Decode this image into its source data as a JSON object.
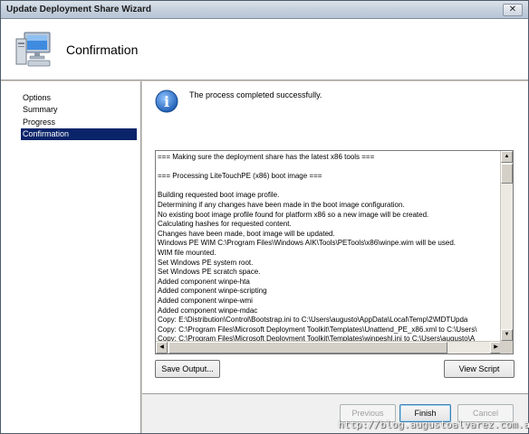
{
  "window": {
    "title": "Update Deployment Share Wizard",
    "close_glyph": "✕"
  },
  "header": {
    "heading": "Confirmation",
    "icon": "computer-monitor-icon"
  },
  "sidebar": {
    "items": [
      {
        "label": "Options",
        "active": false
      },
      {
        "label": "Summary",
        "active": false
      },
      {
        "label": "Progress",
        "active": false
      },
      {
        "label": "Confirmation",
        "active": true
      }
    ]
  },
  "main": {
    "status_icon": "info-icon",
    "status_icon_glyph": "i",
    "status_text": "The process completed successfully.",
    "log_lines": [
      "=== Making sure the deployment share has the latest x86 tools ===",
      "",
      "=== Processing LiteTouchPE (x86) boot image ===",
      "",
      "Building requested boot image profile.",
      "Determining if any changes have been made in the boot image configuration.",
      "No existing boot image profile found for platform x86 so a new image will be created.",
      "Calculating hashes for requested content.",
      "Changes have been made, boot image will be updated.",
      "Windows PE WIM C:\\Program Files\\Windows AIK\\Tools\\PETools\\x86\\winpe.wim will be used.",
      "WIM file mounted.",
      "Set Windows PE system root.",
      "Set Windows PE scratch space.",
      "Added component winpe-hta",
      "Added component winpe-scripting",
      "Added component winpe-wmi",
      "Added component winpe-mdac",
      "Copy: E:\\Distribution\\Control\\Bootstrap.ini to C:\\Users\\augusto\\AppData\\Local\\Temp\\2\\MDTUpda",
      "Copy: C:\\Program Files\\Microsoft Deployment Toolkit\\Templates\\Unattend_PE_x86.xml to C:\\Users\\",
      "Copy: C:\\Program Files\\Microsoft Deployment Toolkit\\Templates\\winpeshl.ini to C:\\Users\\augusto\\A"
    ],
    "scroll_up_glyph": "▲",
    "scroll_down_glyph": "▼",
    "scroll_left_glyph": "◀",
    "scroll_right_glyph": "▶",
    "save_output_label": "Save Output...",
    "view_script_label": "View Script"
  },
  "footer": {
    "previous_label": "Previous",
    "finish_label": "Finish",
    "cancel_label": "Cancel"
  },
  "watermark": "http://blog.augustoalvarez.com.ar/",
  "colors": {
    "selection": "#0a246a",
    "info_blue": "#1f5fb5",
    "dialog_gray": "#d4d0c8"
  }
}
